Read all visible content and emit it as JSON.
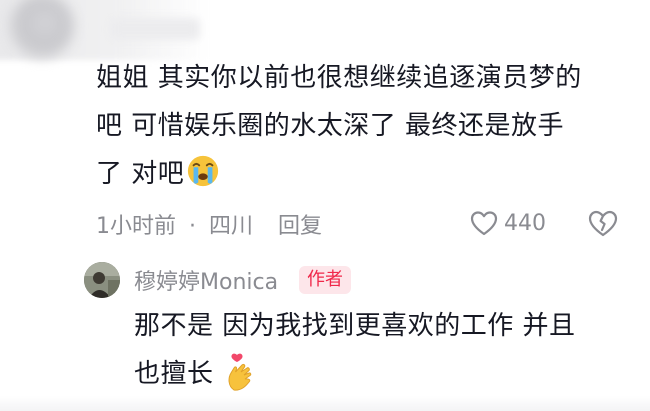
{
  "comment": {
    "lines": [
      "姐姐 其实你以前也很想继续追逐演员梦的",
      "吧 可惜娱乐圈的水太深了 最终还是放手",
      "了 对吧"
    ],
    "emoji": "crying-face-emoji",
    "time": "1小时前",
    "separator": "·",
    "location": "四川",
    "reply_label": "回复",
    "like_count": "440"
  },
  "reply": {
    "username": "穆婷婷Monica",
    "badge": "作者",
    "lines": [
      "那不是 因为我找到更喜欢的工作 并且",
      "也擅长"
    ],
    "emoji": "heart-hands-emoji"
  },
  "colors": {
    "text_primary": "#161823",
    "text_secondary": "#8a8b91",
    "badge_bg": "#fde6ea",
    "badge_text": "#f0284a"
  }
}
